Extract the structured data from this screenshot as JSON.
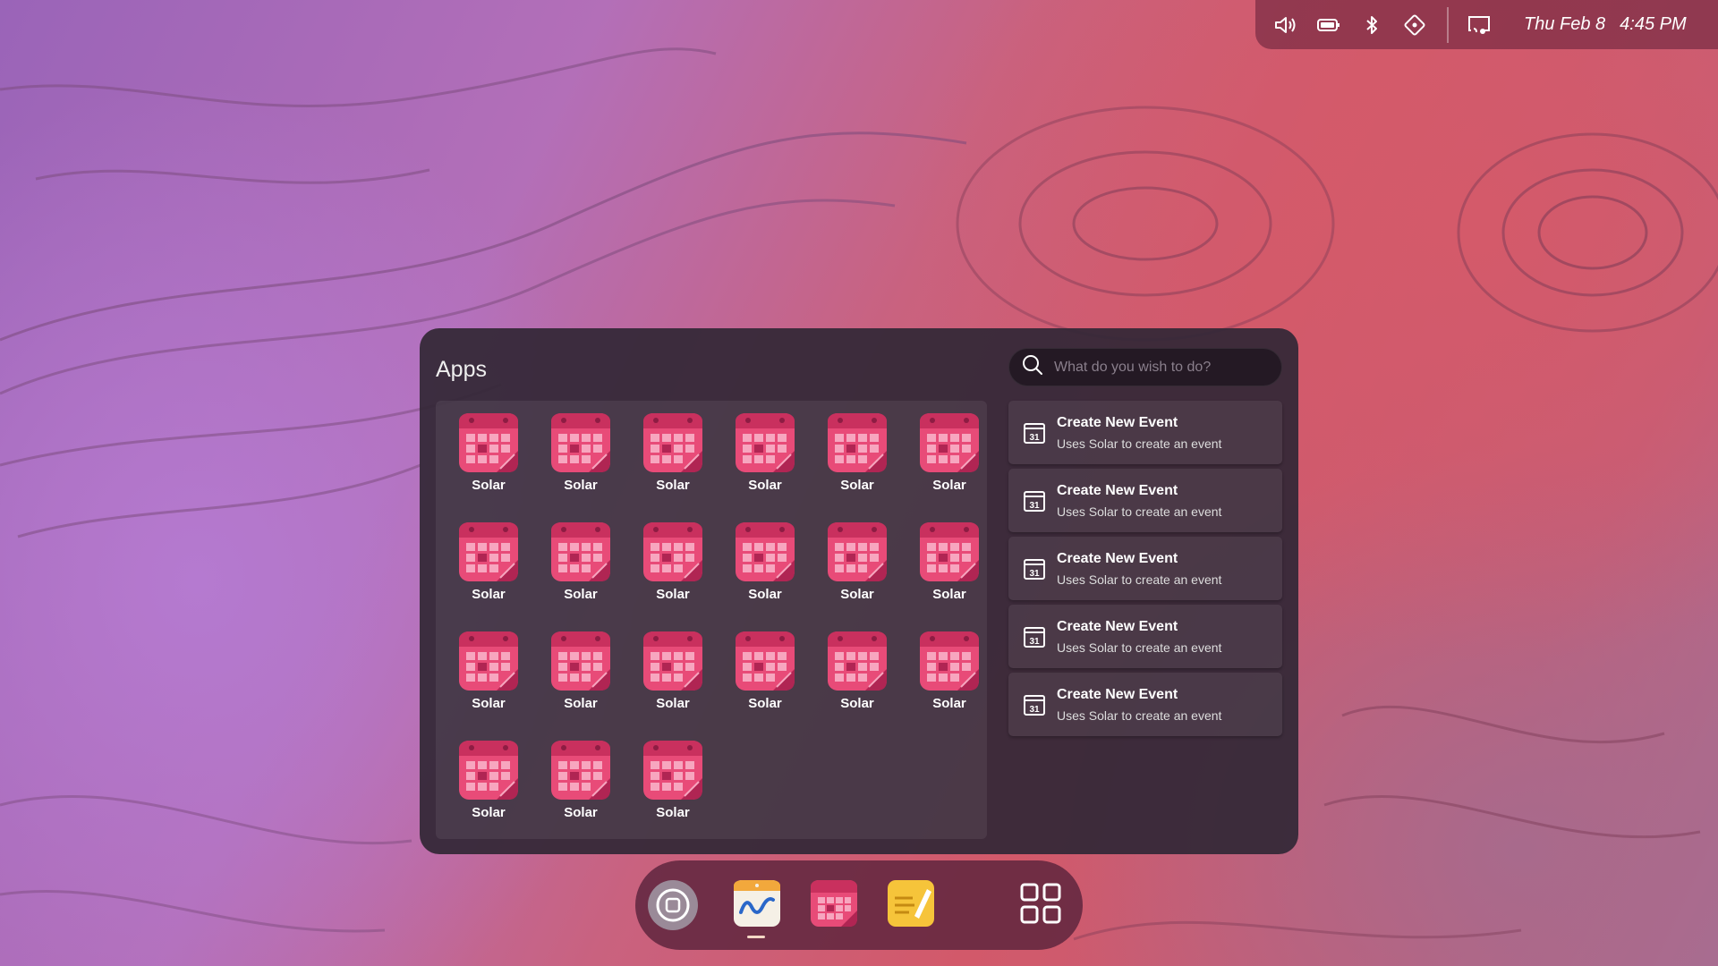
{
  "status_bar": {
    "date": "Thu Feb 8",
    "time": "4:45 PM",
    "icons": [
      "volume-icon",
      "battery-icon",
      "bluetooth-icon",
      "location-icon",
      "screen-cast-icon"
    ]
  },
  "apps_panel": {
    "title": "Apps",
    "apps": [
      {
        "label": "Solar"
      },
      {
        "label": "Solar"
      },
      {
        "label": "Solar"
      },
      {
        "label": "Solar"
      },
      {
        "label": "Solar"
      },
      {
        "label": "Solar"
      },
      {
        "label": "Solar"
      },
      {
        "label": "Solar"
      },
      {
        "label": "Solar"
      },
      {
        "label": "Solar"
      },
      {
        "label": "Solar"
      },
      {
        "label": "Solar"
      },
      {
        "label": "Solar"
      },
      {
        "label": "Solar"
      },
      {
        "label": "Solar"
      },
      {
        "label": "Solar"
      },
      {
        "label": "Solar"
      },
      {
        "label": "Solar"
      },
      {
        "label": "Solar"
      },
      {
        "label": "Solar"
      },
      {
        "label": "Solar"
      }
    ]
  },
  "search": {
    "placeholder": "What do you wish to do?",
    "value": ""
  },
  "actions": [
    {
      "title": "Create New Event",
      "subtitle": "Uses Solar to create an event",
      "icon": "calendar-31-icon"
    },
    {
      "title": "Create New Event",
      "subtitle": "Uses Solar to create an event",
      "icon": "calendar-31-icon"
    },
    {
      "title": "Create New Event",
      "subtitle": "Uses Solar to create an event",
      "icon": "calendar-31-icon"
    },
    {
      "title": "Create New Event",
      "subtitle": "Uses Solar to create an event",
      "icon": "calendar-31-icon"
    },
    {
      "title": "Create New Event",
      "subtitle": "Uses Solar to create an event",
      "icon": "calendar-31-icon"
    }
  ],
  "dock": {
    "items": [
      "home-button-icon",
      "whiteboard-app-icon",
      "calendar-app-icon",
      "notes-app-icon",
      "app-grid-icon"
    ],
    "active_item": "whiteboard-app-icon"
  },
  "colors": {
    "accent_pink": "#e84b78",
    "panel": "#342837",
    "dock": "#5a233c"
  }
}
